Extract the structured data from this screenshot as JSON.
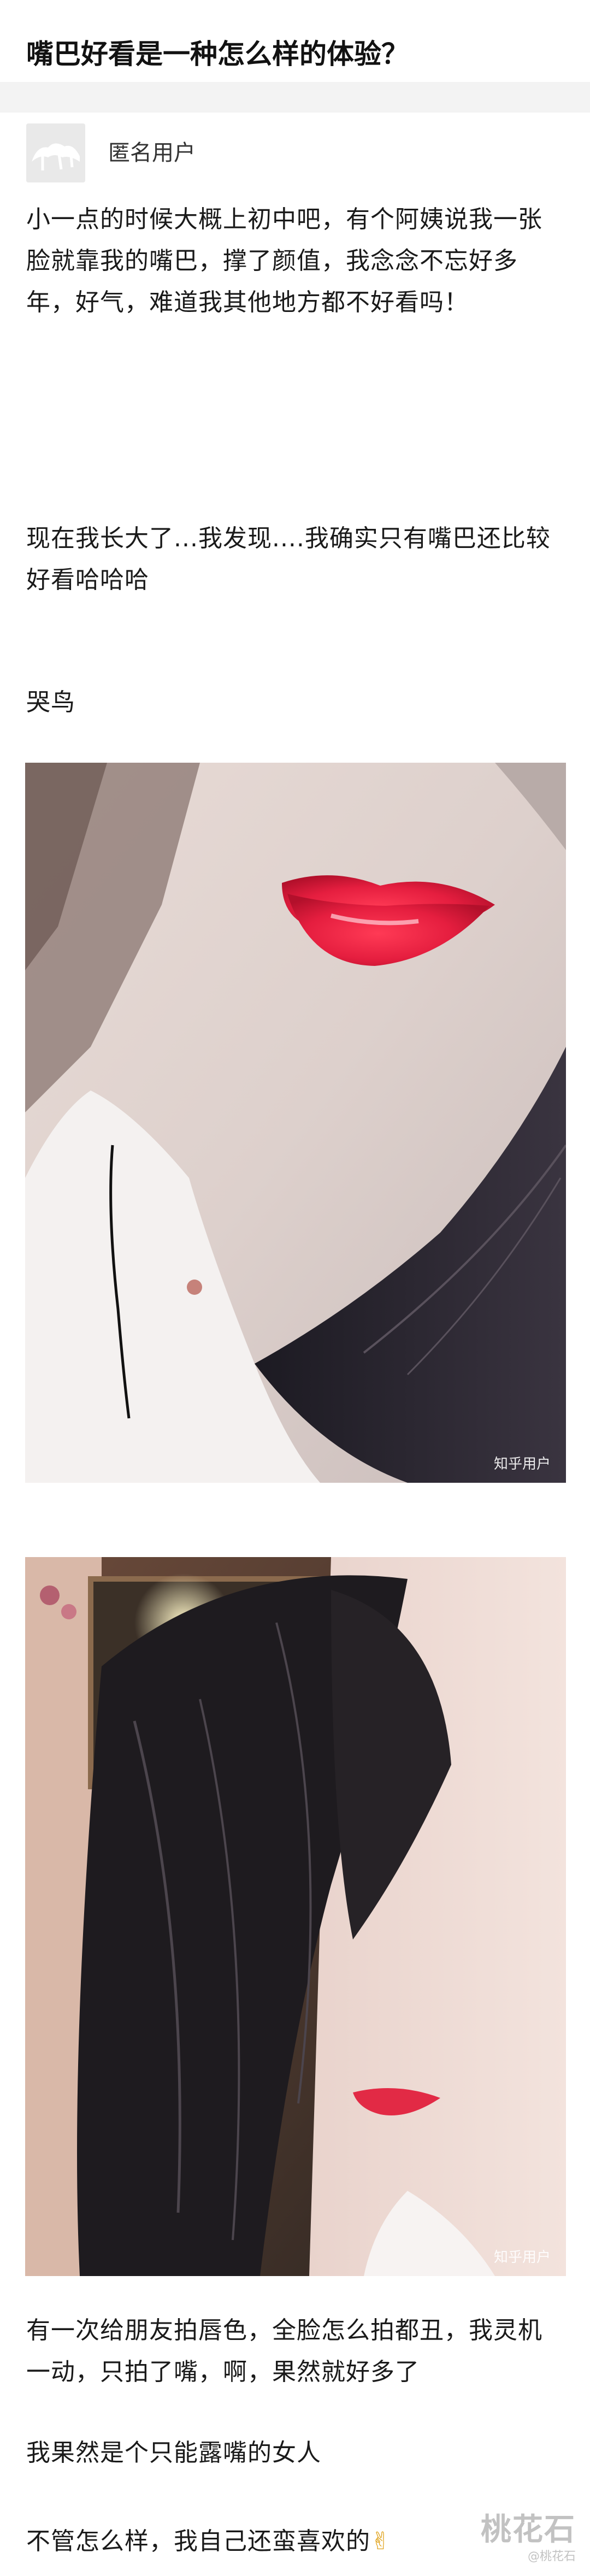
{
  "question": {
    "title": "嘴巴好看是一种怎么样的体验？"
  },
  "author": {
    "name": "匿名用户",
    "avatar_icon": "anonymous-avatar-icon"
  },
  "answer": {
    "paragraphs": [
      "小一点的时候大概上初中吧，有个阿姨说我一张脸就靠我的嘴巴，撑了颜值，我念念不忘好多年，好气，难道我其他地方都不好看吗！",
      "现在我长大了...我发现....我确实只有嘴巴还比较好看哈哈哈",
      "哭鸟"
    ],
    "images": [
      {
        "watermark": "知乎用户",
        "subject": "lips-closeup-photo"
      },
      {
        "watermark": "知乎用户",
        "subject": "face-with-hair-photo"
      }
    ],
    "after_paragraphs": [
      "有一次给朋友拍唇色，全脸怎么拍都丑，我灵机一动，只拍了嘴，啊，果然就好多了",
      "我果然是个只能露嘴的女人",
      "不管怎么样，我自己还蛮喜欢的"
    ],
    "emoji": "✌"
  },
  "watermark": {
    "brand": "桃花石",
    "handle": "@桃花石"
  }
}
